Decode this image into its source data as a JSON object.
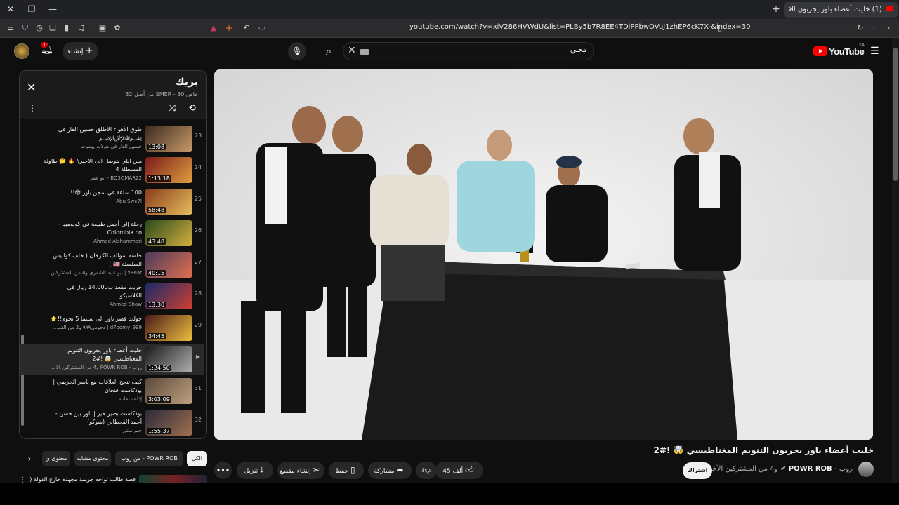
{
  "browser": {
    "tab_title": "(1) خليت أعضاء باور يجربون التـ",
    "tab_close": "✕",
    "new_tab": "+",
    "url": "youtube.com/watch?v=xiV286HVWdU&list=PLBy5b7R8EE4TDiPPbwOVuJ1zhEP6cK7X-&index=30"
  },
  "header": {
    "logo_text": "YouTube",
    "country": "SA",
    "search_query": "مجبي",
    "create_label": "إنشاء",
    "notifications": "1"
  },
  "playlist": {
    "title": "بريك",
    "subtitle": "خاص SMER - 30 من أصل 32",
    "items": [
      {
        "num": "23",
        "title": "طوق الأهواء الأطلق حسين القار في ﷽",
        "channel": "حسين القار في هولات يوميات",
        "duration": "13:08"
      },
      {
        "num": "24",
        "title": "مين اللي يتوصل الى الاخير؟ 🔥 🤔 طاولة المسطلة 4",
        "channel": "BO3OMAR22 - ابو عمر",
        "duration": "1:13:18"
      },
      {
        "num": "25",
        "title": "100 ساعة في سجن باور 😳!!",
        "channel": "Abu Swe7l",
        "duration": "58:48"
      },
      {
        "num": "26",
        "title": "رحلة إلى أجمل طبيعة في كولومبيا - Colombia co",
        "channel": "Ahmed Alshammari",
        "duration": "43:48"
      },
      {
        "num": "27",
        "title": "جلسة سوالف الكرخان ( خلف كواليس السلسلة 🇺🇸 )",
        "channel": "xBear | ابو عابد الشمري و4 من المشتركين ...",
        "duration": "40:15"
      },
      {
        "num": "28",
        "title": "جربت مقعد ب14,000 ريال في الكلاسيكو",
        "channel": "Ahmed Show",
        "duration": "13:30"
      },
      {
        "num": "29",
        "title": "حولت قصر باور الى سينما 5 نجوم!!⭐",
        "channel": "d7oomy_999 | دحومي٩٩٩ و2 من القنـ...",
        "duration": "34:45"
      },
      {
        "num": "",
        "title": "خليت أعضاء باور يجربون التنويم المغناطيسي 🤯 !#2",
        "channel": "روب - POWR ROB و4 من المشتركين الآ...",
        "duration": "1:24:50",
        "active": true
      },
      {
        "num": "31",
        "title": "كيف تنجح العلاقات مع ياسر الحزيمي | بودكاست فنجان",
        "channel": "إذاعة ثمانية",
        "duration": "3:03:09"
      },
      {
        "num": "32",
        "title": "بودكاست بصير خير | باور بين حسن - أحمد القحطاني (شوكو)",
        "channel": "جيم ستور",
        "duration": "1:55:37"
      }
    ]
  },
  "chips": {
    "all": "الكل",
    "from_rob": "من روب - POWR ROB",
    "similar": "محتوى مشابه",
    "more": "محتوى ي"
  },
  "next_video": {
    "title": "قصة طالب تواجه جريمة مجهدة خارج الدولة ("
  },
  "video": {
    "title": "خليت أعضاء باور يجربون التنويم المغناطيسي 🤯 !#2",
    "channel_prefix": "روب -",
    "channel_name": "POWR ROB",
    "channel_suffix": "و4 من المشتركين الآخرين",
    "subscribe": "اشتراك",
    "likes": "45 ألف",
    "share": "مشاركة",
    "save": "حفظ",
    "clip": "إنشاء مقطع",
    "download": "تنزيل"
  },
  "colors": {
    "background": "#0f0f0f",
    "accent_red": "#ff0000",
    "chip_bg": "#272727"
  }
}
